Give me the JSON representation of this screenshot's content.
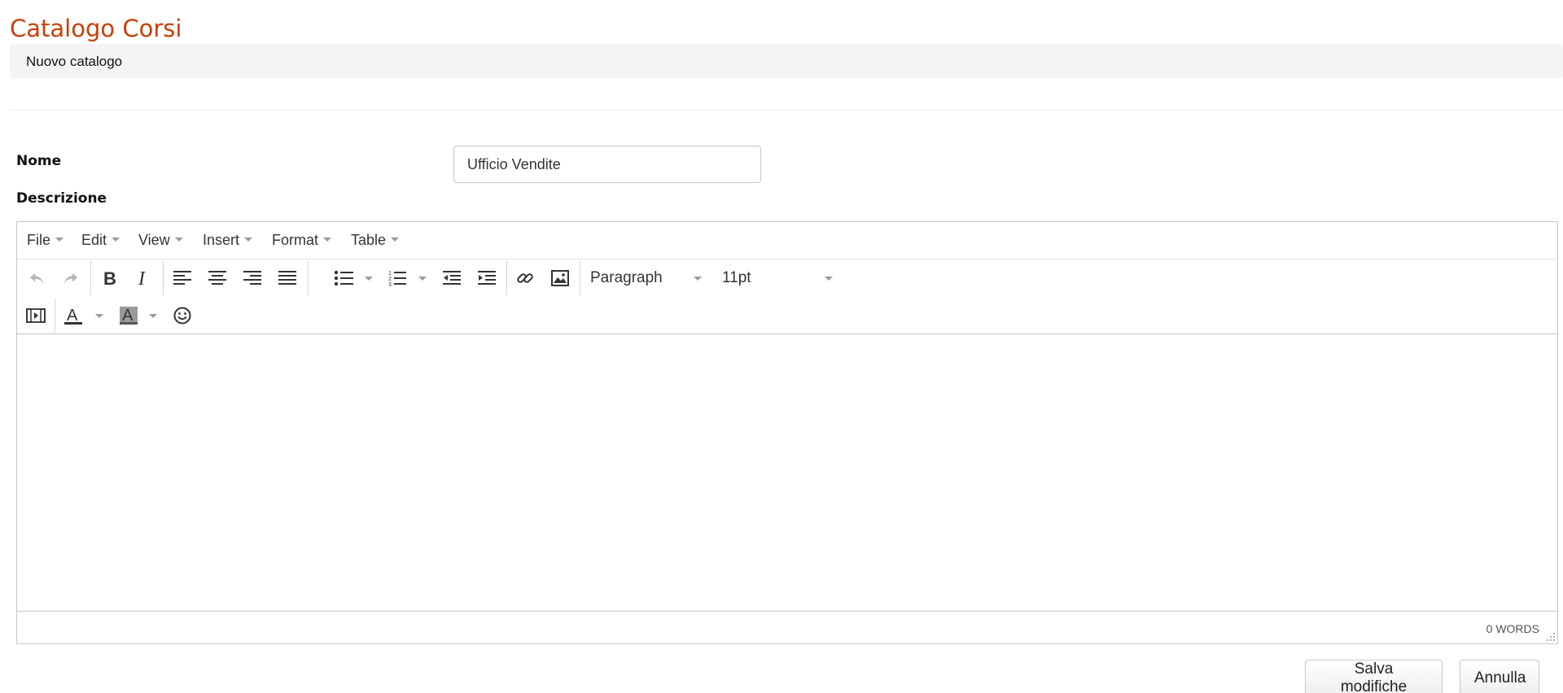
{
  "page": {
    "title": "Catalogo Corsi",
    "subtitle": "Nuovo catalogo"
  },
  "form": {
    "name_label": "Nome",
    "name_value": "Ufficio Vendite",
    "description_label": "Descrizione"
  },
  "editor": {
    "menu": [
      "File",
      "Edit",
      "View",
      "Insert",
      "Format",
      "Table"
    ],
    "block_format": "Paragraph",
    "font_size": "11pt",
    "word_count": "0 WORDS"
  },
  "actions": {
    "save": "Salva modifiche",
    "cancel": "Annulla"
  },
  "colors": {
    "title": "#c8400a",
    "subbar_bg": "#f4f4f4",
    "icon": "#333333"
  },
  "icons": [
    "undo-icon",
    "redo-icon",
    "bold-icon",
    "italic-icon",
    "align-left-icon",
    "align-center-icon",
    "align-right-icon",
    "align-justify-icon",
    "bullet-list-icon",
    "numbered-list-icon",
    "outdent-icon",
    "indent-icon",
    "link-icon",
    "image-icon",
    "media-icon",
    "text-color-icon",
    "background-color-icon",
    "emoticons-icon",
    "resize-handle-icon"
  ]
}
